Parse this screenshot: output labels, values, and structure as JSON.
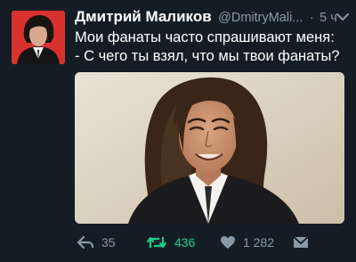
{
  "tweet": {
    "author_name": "Дмитрий Маликов",
    "author_handle": "@DmitryMali...",
    "separator": "·",
    "time": "5 ч",
    "text_line1": "Мои фанаты часто спрашивают меня:",
    "text_line2": "- С чего ты взял, что мы твои фанаты?",
    "replies": "35",
    "retweets": "436",
    "likes": "1 282"
  },
  "icons": {
    "reply": "reply-icon",
    "retweet": "retweet-icon",
    "like": "heart-icon",
    "message": "direct-message-icon",
    "menu": "chevron-down-icon"
  },
  "colors": {
    "background": "#141d26",
    "text": "#ffffff",
    "muted": "#8899a6",
    "retweet_active": "#19cf86",
    "avatar_bg": "#d8322f"
  }
}
